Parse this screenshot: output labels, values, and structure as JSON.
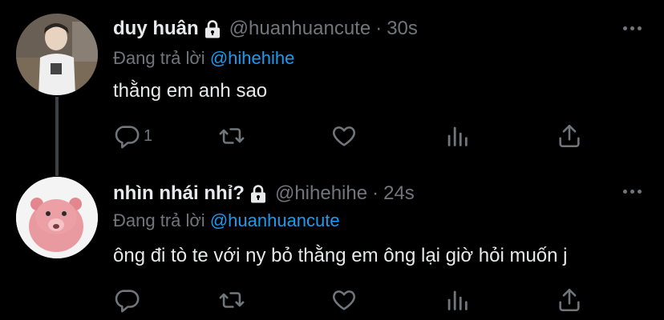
{
  "tweets": [
    {
      "name": "duy huân",
      "handle": "@huanhuancute",
      "separator": "·",
      "time": "30s",
      "reply_prefix": "Đang trả lời",
      "reply_to": "@hihehihe",
      "text": "thằng em anh sao",
      "reply_count": "1",
      "protected": true
    },
    {
      "name": "nhìn nhái nhỉ?",
      "handle": "@hihehihe",
      "separator": "·",
      "time": "24s",
      "reply_prefix": "Đang trả lời",
      "reply_to": "@huanhuancute",
      "text": "ông đi tò te với ny bỏ thằng em ông lại giờ hỏi muốn j",
      "reply_count": "",
      "protected": true
    }
  ],
  "icons": {
    "reply": "reply-icon",
    "retweet": "retweet-icon",
    "like": "like-icon",
    "views": "views-icon",
    "share": "share-icon",
    "more": "more-icon",
    "lock": "lock-icon"
  },
  "colors": {
    "background": "#000000",
    "text": "#e7e9ea",
    "muted": "#71767b",
    "link": "#1d9bf0",
    "thread_line": "#3e4144"
  }
}
